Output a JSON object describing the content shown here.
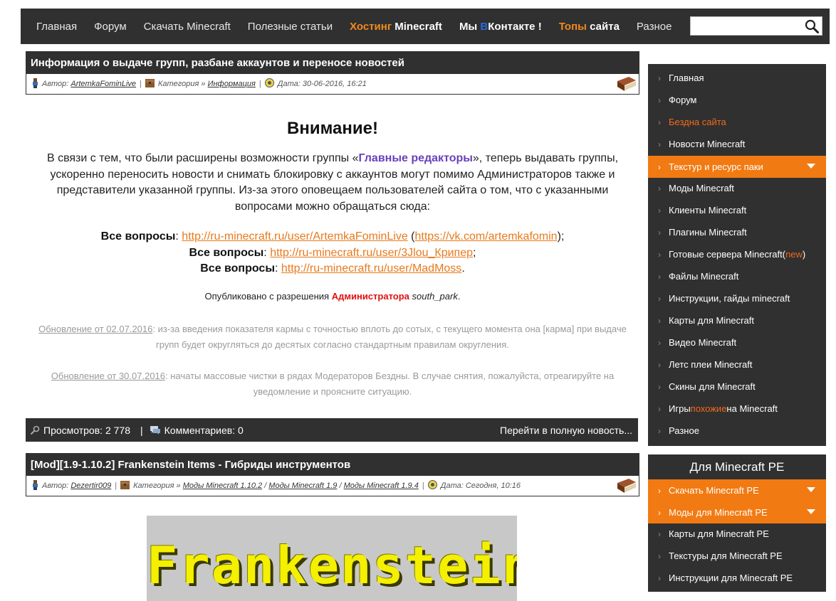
{
  "nav": {
    "items": [
      {
        "label": "Главная"
      },
      {
        "label": "Форум"
      },
      {
        "label": "Скачать Minecraft"
      },
      {
        "label": "Полезные статьи"
      }
    ],
    "hosting_accent": "Хостинг",
    "hosting_rest": " Minecraft",
    "vk_pre": "Мы ",
    "vk_b": "В",
    "vk_post": "Контакте !",
    "tops_accent": "Топы",
    "tops_rest": " сайта",
    "misc": "Разное",
    "search_value": "",
    "accent_color": "#f08a1c"
  },
  "post1": {
    "title": "Информация о выдаче групп, разбане аккаунтов и переносе новостей",
    "author_label": "Автор:",
    "author": "ArtemkaFominLive",
    "category_label": "Категория »",
    "category": "Информация",
    "date": "Дата: 30-06-2016, 16:21",
    "heading": "Внимание!",
    "para_before": "В связи с тем, что были расширены возможности группы «",
    "group_name": "Главные редакторы",
    "para_after": "», теперь выдавать группы, ускоренно переносить новости и снимать блокировку с аккаунтов могут помимо Администраторов также и представители указанной группы. Из-за этого оповещаем пользователей сайта о том, что с указанными вопросами можно обращаться сюда:",
    "questions_label": "Все вопросы",
    "q1_link": "http://ru-minecraft.ru/user/ArtemkaFominLive",
    "q1_vk": "https://vk.com/artemkafomin",
    "q2_link": "http://ru-minecraft.ru/user/3Jlou_Крипер",
    "q3_link": "http://ru-minecraft.ru/user/MadMoss",
    "published_pre": "Опубликовано с разрешения ",
    "published_admin": "Администратора",
    "published_user": "south_park",
    "update1_link": "Обновление от 02.07.2016",
    "update1_text": ": из-за введения показателя кармы с точностью вплоть до сотых, с текущего момента она [карма] при выдаче групп будет округляться до десятых согласно стандартным правилам округления.",
    "update2_link": "Обновление от 30.07.2016",
    "update2_text": ": начаты массовые чистки в рядах Модераторов Бездны. В случае снятия, пожалуйста, отреагируйте на уведомление и проясните ситуацию.",
    "views": "Просмотров: 2 778",
    "comments": "Комментариев: 0",
    "read_more": "Перейти в полную новость..."
  },
  "post2": {
    "title": "[Mod][1.9-1.10.2] Frankenstein Items - Гибриды инструментов",
    "author_label": "Автор:",
    "author": "Dezertir009",
    "category_label": "Категория »",
    "categories": [
      "Моды Minecraft 1.10.2",
      "Моды Minecraft 1.9",
      "Моды Minecraft 1.9.4"
    ],
    "date": "Дата: Сегодня, 10:16",
    "image_text": "Frankenstein"
  },
  "sidebar": {
    "items": [
      {
        "label": "Главная"
      },
      {
        "label": "Форум"
      },
      {
        "label": "Бездна сайта"
      },
      {
        "label": "Новости Minecraft"
      },
      {
        "label": "Текстур и ресурс паки"
      },
      {
        "label": "Моды Minecraft"
      },
      {
        "label": "Клиенты Minecraft"
      },
      {
        "label": "Плагины Minecraft"
      },
      {
        "label": "Готовые сервера Minecraft("
      },
      {
        "label": "Файлы Minecraft"
      },
      {
        "label": "Инструкции, гайды minecraft"
      },
      {
        "label": "Карты для Minecraft"
      },
      {
        "label": "Видео Minecraft"
      },
      {
        "label": "Летс плеи Minecraft"
      },
      {
        "label": "Скины для Minecraft"
      },
      {
        "label": "Игры "
      },
      {
        "label": "Разное"
      }
    ],
    "new_tag": "new",
    "servers_close": ")",
    "games_similar": "похожие",
    "games_rest": " на Minecraft",
    "pe_heading": "Для Minecraft PE",
    "pe_items": [
      {
        "label": "Скачать Minecraft PE"
      },
      {
        "label": "Моды для Minecraft PE"
      },
      {
        "label": "Карты для Minecraft PE"
      },
      {
        "label": "Текстуры для Minecraft PE"
      },
      {
        "label": "Инструкции для Minecraft PE"
      }
    ],
    "active_color": "#f27a12"
  }
}
